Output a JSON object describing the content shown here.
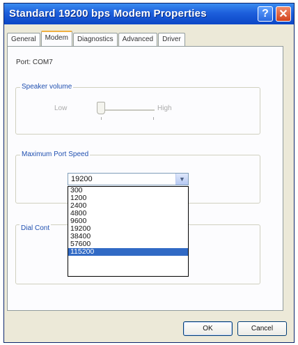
{
  "window": {
    "title": "Standard 19200 bps Modem Properties"
  },
  "titlebar": {
    "help_glyph": "?",
    "close_glyph": "✕"
  },
  "tabs": [
    {
      "label": "General"
    },
    {
      "label": "Modem"
    },
    {
      "label": "Diagnostics"
    },
    {
      "label": "Advanced"
    },
    {
      "label": "Driver"
    }
  ],
  "active_tab": "Modem",
  "modem": {
    "port_label": "Port: COM7",
    "speaker": {
      "title": "Speaker volume",
      "low": "Low",
      "high": "High",
      "level": 0
    },
    "speed": {
      "title": "Maximum Port Speed",
      "selected": "19200"
    },
    "dropdown_options": [
      "300",
      "1200",
      "2400",
      "4800",
      "9600",
      "19200",
      "38400",
      "57600",
      "115200"
    ],
    "highlighted_option": "115200",
    "dial": {
      "title": "Dial Cont"
    }
  },
  "buttons": {
    "ok": "OK",
    "cancel": "Cancel"
  },
  "icons": {
    "combo_arrow": "chevron-down-icon"
  },
  "colors": {
    "titlebar": "#1d5fdc",
    "selection": "#316ac5",
    "tab_accent": "#f0b040"
  }
}
